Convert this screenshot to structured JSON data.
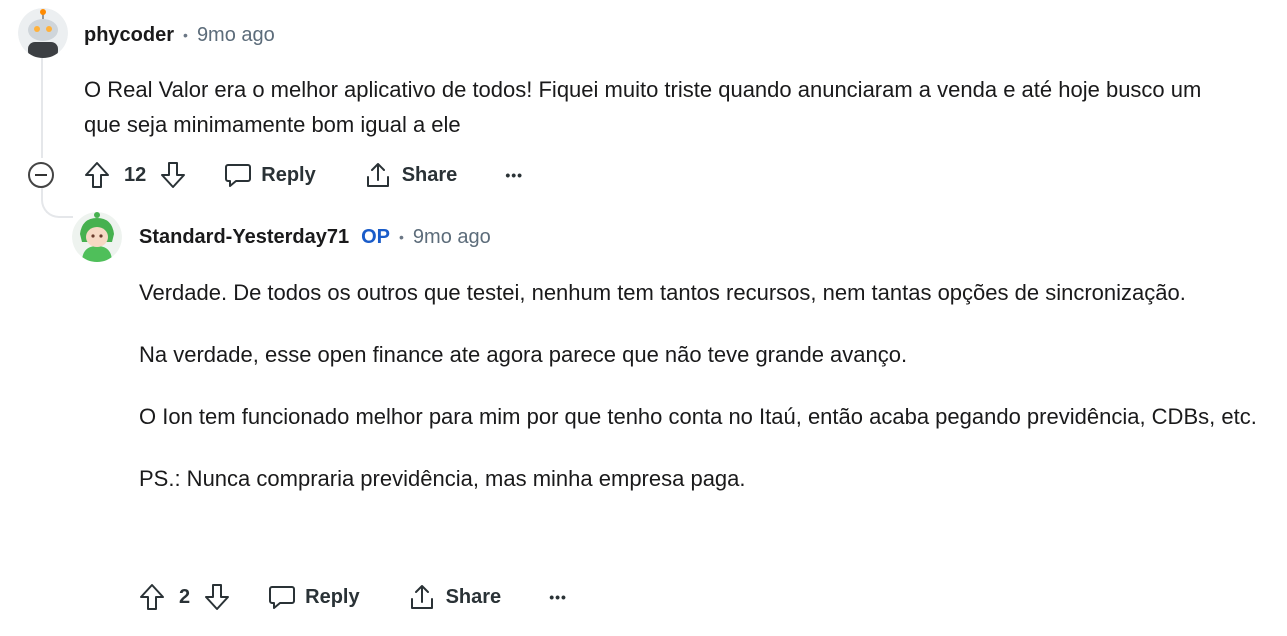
{
  "comments": [
    {
      "author": "phycoder",
      "time": "9mo ago",
      "body": [
        "O Real Valor era o melhor aplicativo de todos! Fiquei muito triste quando anunciaram a venda e até hoje busco um que seja minimamente bom igual a ele"
      ],
      "votes": "12",
      "reply_label": "Reply",
      "share_label": "Share",
      "more_label": "•••"
    },
    {
      "author": "Standard-Yesterday71",
      "op_label": "OP",
      "time": "9mo ago",
      "body": [
        "Verdade. De todos os outros que testei, nenhum tem tantos recursos, nem tantas opções de sincronização.",
        "Na verdade, esse open finance ate agora parece que não teve grande avanço.",
        "O Ion tem funcionado melhor para mim por que tenho conta no Itaú, então acaba pegando previdência, CDBs, etc.",
        "PS.: Nunca compraria previdência, mas minha empresa paga."
      ],
      "votes": "2",
      "reply_label": "Reply",
      "share_label": "Share",
      "more_label": "•••"
    }
  ],
  "colors": {
    "op": "#1a5cc9",
    "meta": "#5c6c7a",
    "text": "#1a1a1b",
    "thread": "#e5e7ea"
  },
  "icons": [
    "upvote-icon",
    "downvote-icon",
    "comment-icon",
    "share-icon",
    "collapse-icon"
  ]
}
